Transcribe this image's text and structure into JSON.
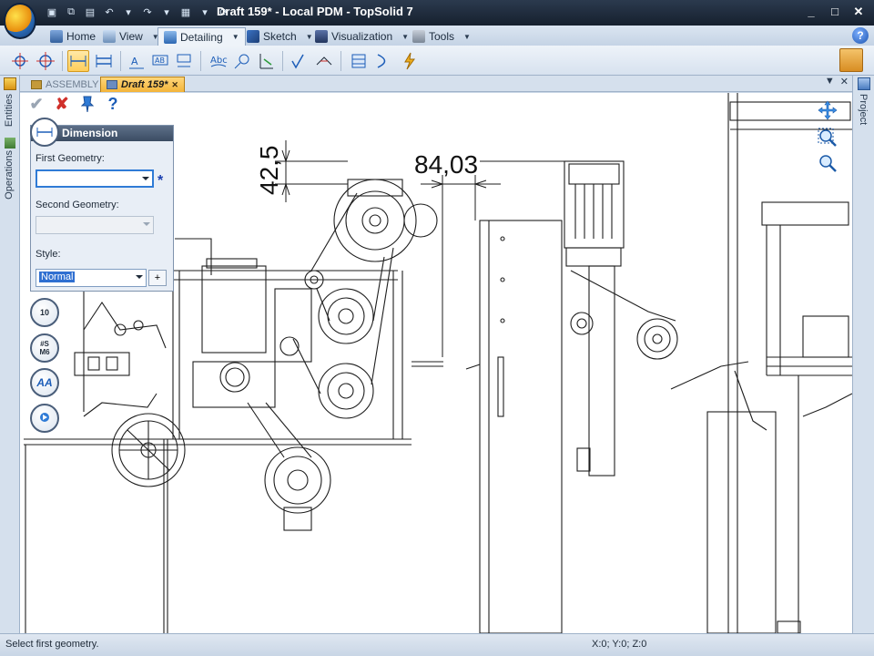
{
  "window": {
    "title": "Draft 159* - Local PDM - TopSolid 7"
  },
  "ribbon_tabs": [
    {
      "label": "Home"
    },
    {
      "label": "View"
    },
    {
      "label": "Detailing"
    },
    {
      "label": "Sketch"
    },
    {
      "label": "Visualization"
    },
    {
      "label": "Tools"
    }
  ],
  "document_tabs": [
    {
      "label": "ASSEMBLY"
    },
    {
      "label": "Draft 159*"
    }
  ],
  "side_docks": {
    "left_top": "Entities",
    "left_bottom": "Operations",
    "right": "Project"
  },
  "dimension_panel": {
    "title": "Dimension",
    "first_geometry_label": "First Geometry:",
    "first_geometry_value": "",
    "second_geometry_label": "Second Geometry:",
    "second_geometry_value": "",
    "style_label": "Style:",
    "style_value": "Normal",
    "style_add": "+",
    "required_marker": "*"
  },
  "side_buttons": [
    {
      "label": "10",
      "icon": "tolerance-icon"
    },
    {
      "label": "#S M6",
      "icon": "thread-icon"
    },
    {
      "label": "AA",
      "icon": "text-style-icon"
    },
    {
      "label": "",
      "icon": "options-icon"
    }
  ],
  "drawing": {
    "dimension_vertical": "42,5",
    "dimension_horizontal": "84,03"
  },
  "status": {
    "message": "Select first geometry.",
    "coordinates": "X:0; Y:0; Z:0"
  },
  "colors": {
    "accent": "#f3b43a",
    "title_bar": "#16202e",
    "ribbon": "#dbe5f1"
  }
}
